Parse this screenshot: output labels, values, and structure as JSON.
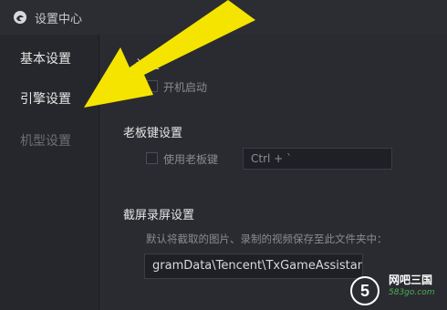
{
  "window": {
    "title": "设置中心"
  },
  "sidebar": {
    "items": [
      {
        "label": "基本设置"
      },
      {
        "label": "引擎设置"
      },
      {
        "label": "机型设置"
      }
    ]
  },
  "main": {
    "startup": {
      "title": "设置",
      "checkbox_label": "开机启动"
    },
    "boss_key": {
      "title": "老板键设置",
      "checkbox_label": "使用老板键",
      "hotkey_value": "Ctrl + `"
    },
    "screenshot": {
      "title": "截屏录屏设置",
      "description": "默认将截取的图片、录制的视频保存至此文件夹中：",
      "path": "gramData\\Tencent\\TxGameAssistant\\Snapshot"
    }
  },
  "watermark": {
    "site": "网吧三国",
    "url": "583go.com",
    "logo_number": "5"
  },
  "colors": {
    "arrow": "#f5e400",
    "background": "#2a2b31",
    "sidebar": "#26272c"
  }
}
